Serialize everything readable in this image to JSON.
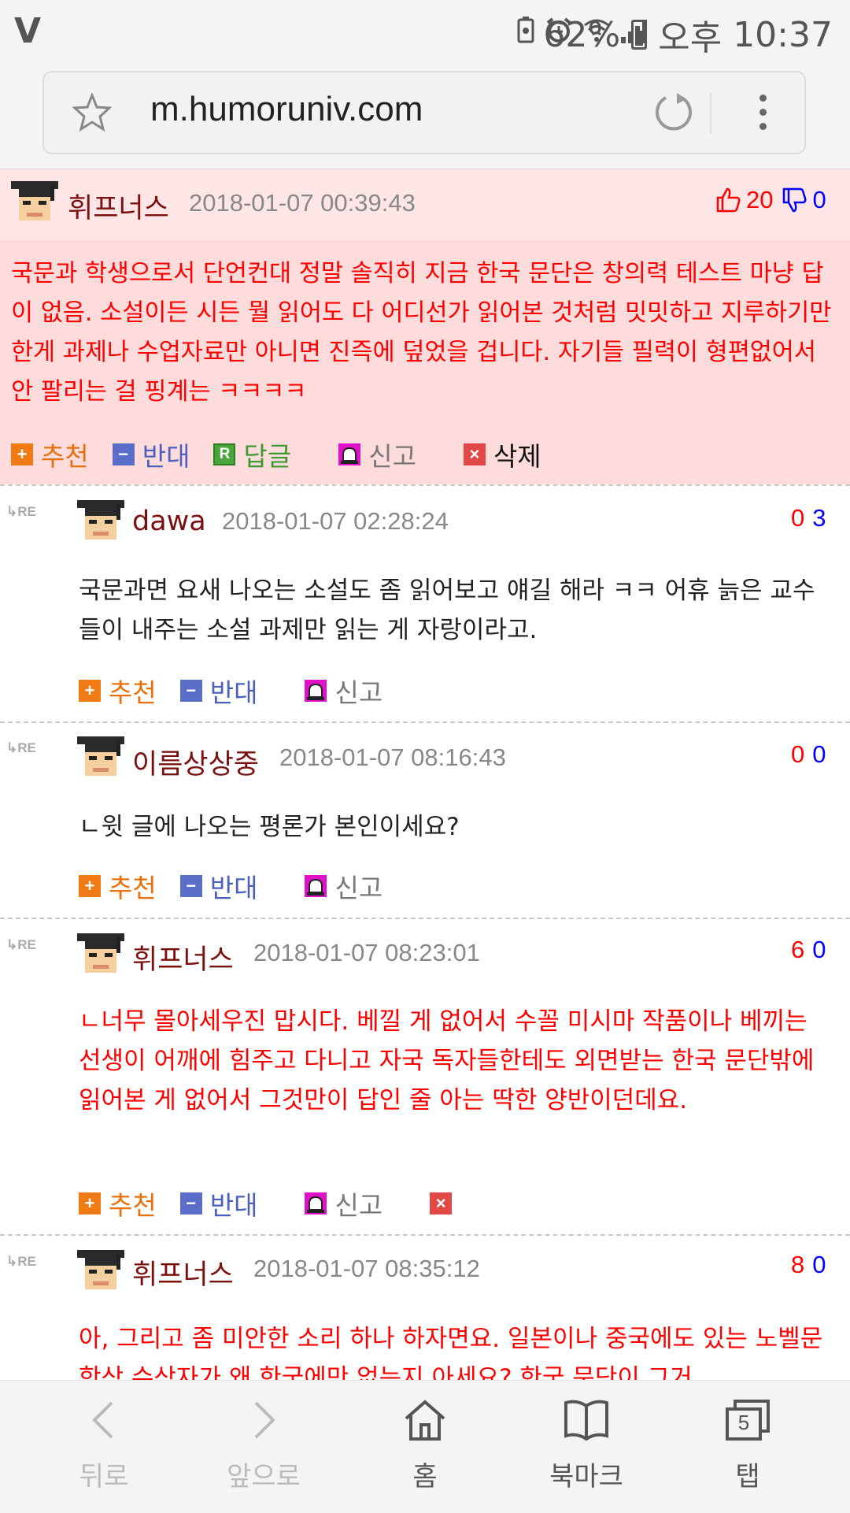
{
  "status_bar": {
    "battery": "62%",
    "ampm": "오후",
    "time": "10:37"
  },
  "browser": {
    "url": "m.humoruniv.com"
  },
  "comments": [
    {
      "author": "휘프너스",
      "date": "2018-01-07 00:39:43",
      "up": "20",
      "down": "0",
      "text": "국문과 학생으로서 단언컨대 정말 솔직히 지금 한국 문단은 창의력 테스트 마냥 답이 없음. 소설이든 시든 뭘 읽어도 다 어디선가 읽어본 것처럼 밋밋하고 지루하기만 한게 과제나 수업자료만 아니면 진즉에 덮었을 겁니다. 자기들 필력이 형편없어서 안 팔리는 걸 핑계는 ㅋㅋㅋㅋ",
      "actions": {
        "recommend": "추천",
        "oppose": "반대",
        "reply": "답글",
        "report": "신고",
        "delete": "삭제"
      }
    },
    {
      "author": "dawa",
      "date": "2018-01-07 02:28:24",
      "up": "0",
      "down": "3",
      "text": "국문과면 요새 나오는 소설도 좀 읽어보고 얘길 해라 ㅋㅋ 어휴 늙은 교수들이 내주는 소설 과제만 읽는 게 자랑이라고.",
      "actions": {
        "recommend": "추천",
        "oppose": "반대",
        "report": "신고"
      }
    },
    {
      "author": "이름상상중",
      "date": "2018-01-07 08:16:43",
      "up": "0",
      "down": "0",
      "text": "ㄴ윗 글에 나오는 평론가 본인이세요?",
      "actions": {
        "recommend": "추천",
        "oppose": "반대",
        "report": "신고"
      }
    },
    {
      "author": "휘프너스",
      "date": "2018-01-07 08:23:01",
      "up": "6",
      "down": "0",
      "text": "ㄴ너무 몰아세우진 맙시다. 베낄 게 없어서 수꼴 미시마 작품이나 베끼는 선생이 어깨에 힘주고 다니고 자국 독자들한테도 외면받는 한국 문단밖에 읽어본 게 없어서 그것만이 답인 줄 아는 딱한 양반이던데요.",
      "actions": {
        "recommend": "추천",
        "oppose": "반대",
        "report": "신고"
      }
    },
    {
      "author": "휘프너스",
      "date": "2018-01-07 08:35:12",
      "up": "8",
      "down": "0",
      "text": "아, 그리고 좀 미안한 소리 하나 하자면요. 일본이나 중국에도 있는 노벨문학상 수상자가 왜 한국에만 없는지 아세요? 한국 문단이 그거"
    }
  ],
  "bottom_nav": {
    "back": "뒤로",
    "forward": "앞으로",
    "home": "홈",
    "bookmark": "북마크",
    "tabs": "탭",
    "tab_count": "5"
  },
  "colors": {
    "author": "#7a1010",
    "highlight_bg": "#ffdcdc",
    "head_bg": "#ffe6e6",
    "red_text": "#ff0000",
    "down_vote": "#0000ff"
  }
}
